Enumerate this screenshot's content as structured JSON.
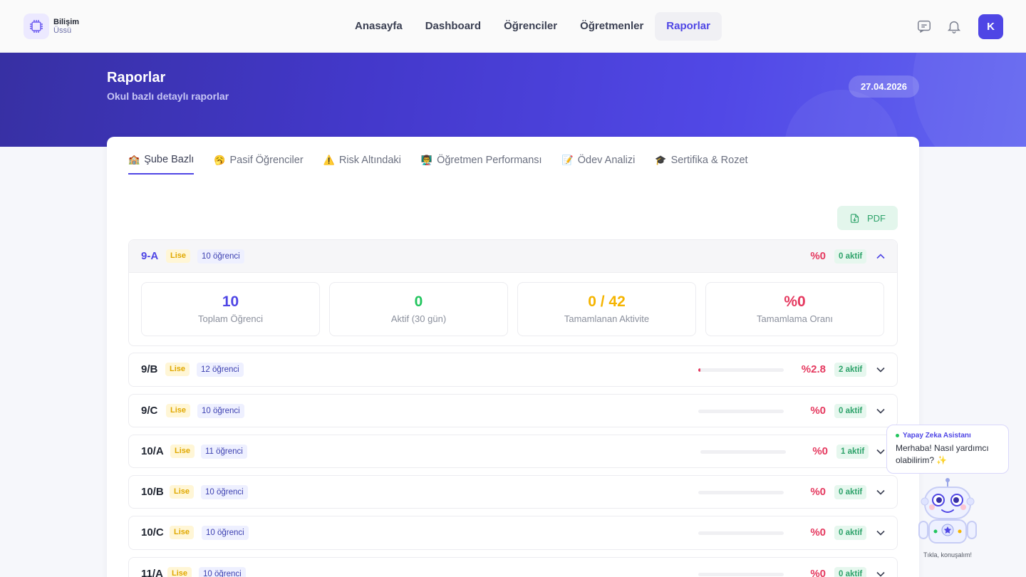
{
  "brand": {
    "line1": "Bilişim",
    "line2": "Üssü",
    "icon": "chip-icon"
  },
  "nav": {
    "links": [
      "Anasayfa",
      "Dashboard",
      "Öğrenciler",
      "Öğretmenler",
      "Raporlar"
    ],
    "active": "Raporlar",
    "avatar": "K"
  },
  "hero": {
    "title": "Raporlar",
    "subtitle": "Okul bazlı detaylı raporlar",
    "date": "27.04.2026"
  },
  "tabs": [
    {
      "emoji": "🏫",
      "label": "Şube Bazlı"
    },
    {
      "emoji": "🥱",
      "label": "Pasif Öğrenciler"
    },
    {
      "emoji": "⚠️",
      "label": "Risk Altındaki"
    },
    {
      "emoji": "👨‍🏫",
      "label": "Öğretmen Performansı"
    },
    {
      "emoji": "📝",
      "label": "Ödev Analizi"
    },
    {
      "emoji": "🎓",
      "label": "Sertifika & Rozet"
    }
  ],
  "pdf_label": "PDF",
  "branches": [
    {
      "name": "9-A",
      "type": "Lise",
      "count": "10 öğrenci",
      "pct": "%0",
      "aktif": "0 aktif",
      "progress": null,
      "expanded": true
    },
    {
      "name": "9/B",
      "type": "Lise",
      "count": "12 öğrenci",
      "pct": "%2.8",
      "aktif": "2 aktif",
      "progress": 0.028,
      "expanded": false
    },
    {
      "name": "9/C",
      "type": "Lise",
      "count": "10 öğrenci",
      "pct": "%0",
      "aktif": "0 aktif",
      "progress": 0,
      "expanded": false
    },
    {
      "name": "10/A",
      "type": "Lise",
      "count": "11 öğrenci",
      "pct": "%0",
      "aktif": "1 aktif",
      "progress": 0,
      "expanded": false
    },
    {
      "name": "10/B",
      "type": "Lise",
      "count": "10 öğrenci",
      "pct": "%0",
      "aktif": "0 aktif",
      "progress": 0,
      "expanded": false
    },
    {
      "name": "10/C",
      "type": "Lise",
      "count": "10 öğrenci",
      "pct": "%0",
      "aktif": "0 aktif",
      "progress": 0,
      "expanded": false
    },
    {
      "name": "11/A",
      "type": "Lise",
      "count": "10 öğrenci",
      "pct": "%0",
      "aktif": "0 aktif",
      "progress": 0,
      "expanded": false
    }
  ],
  "stats": [
    {
      "value": "10",
      "label": "Toplam Öğrenci",
      "color": "#4f46e5"
    },
    {
      "value": "0",
      "label": "Aktif (30 gün)",
      "color": "#22c55e"
    },
    {
      "value": "0 / 42",
      "label": "Tamamlanan Aktivite",
      "color": "#f5b400"
    },
    {
      "value": "%0",
      "label": "Tamamlama Oranı",
      "color": "#e5395f"
    }
  ],
  "assistant": {
    "title": "Yapay Zeka Asistanı",
    "message": "Merhaba! Nasıl yardımcı olabilirim? ✨",
    "caption": "Tıkla, konuşalım!"
  },
  "colors": {
    "primary": "#4f46e5",
    "danger": "#e5395f",
    "success": "#2fa36b",
    "warning": "#e0a800"
  }
}
